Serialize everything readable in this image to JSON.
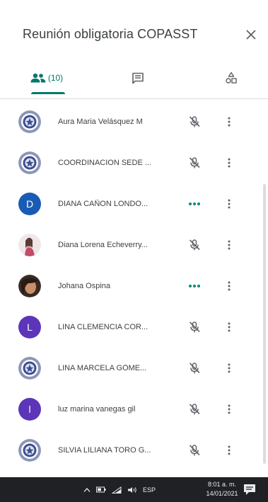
{
  "meeting": {
    "title": "Reunión obligatoria COPASST"
  },
  "tabs": {
    "people_count": "(10)"
  },
  "participants": [
    {
      "name": "Aura Maria Velásquez M",
      "avatar": "logo",
      "status": "mic-off"
    },
    {
      "name": "COORDINACION SEDE ...",
      "avatar": "logo",
      "status": "mic-off"
    },
    {
      "name": "DIANA CAÑON LONDO...",
      "avatar": "D",
      "avatar_color": "#1a5bb5",
      "status": "speaking"
    },
    {
      "name": "Diana Lorena Echeverry...",
      "avatar": "photo-pink",
      "status": "mic-off"
    },
    {
      "name": "Johana Ospina",
      "avatar": "photo-dark",
      "status": "speaking"
    },
    {
      "name": "LINA CLEMENCIA COR...",
      "avatar": "L",
      "avatar_color": "#5c35b8",
      "status": "mic-off"
    },
    {
      "name": "LINA MARCELA GÓME...",
      "avatar": "logo",
      "status": "mic-off"
    },
    {
      "name": "luz marina vanegas gil",
      "avatar": "l",
      "avatar_color": "#5c35b8",
      "status": "mic-off"
    },
    {
      "name": "SILVIA LILIANA TORO G...",
      "avatar": "logo",
      "status": "mic-off"
    }
  ],
  "taskbar": {
    "language": "ESP",
    "time": "8:01 a. m.",
    "date": "14/01/2021"
  },
  "colors": {
    "accent": "#00796b",
    "speaking": "#00897b",
    "icon": "#5f6368"
  }
}
